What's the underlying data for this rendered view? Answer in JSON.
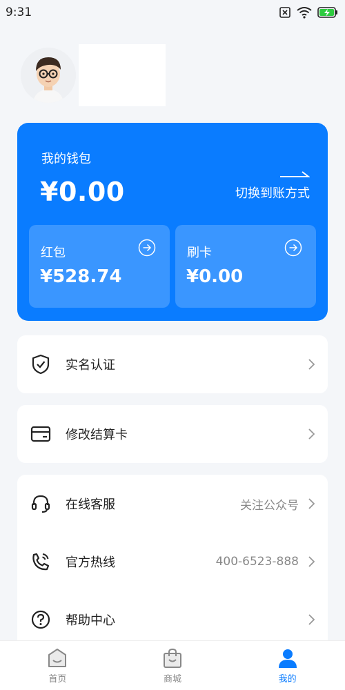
{
  "status_bar": {
    "time": "9:31"
  },
  "wallet": {
    "title": "我的钱包",
    "amount": "¥0.00",
    "switch_label": "切换到账方式",
    "red_packet": {
      "label": "红包",
      "amount": "¥528.74"
    },
    "swipe_card": {
      "label": "刷卡",
      "amount": "¥0.00"
    }
  },
  "menu": {
    "verify": {
      "label": "实名认证"
    },
    "settle_card": {
      "label": "修改结算卡"
    },
    "support": {
      "label": "在线客服",
      "value": "关注公众号"
    },
    "hotline": {
      "label": "官方热线",
      "value": "400-6523-888"
    },
    "help": {
      "label": "帮助中心"
    }
  },
  "tabs": [
    {
      "label": "首页",
      "icon": "home-icon"
    },
    {
      "label": "商城",
      "icon": "shopping-bag-icon"
    },
    {
      "label": "我的",
      "icon": "user-icon"
    }
  ],
  "colors": {
    "accent": "#0a7cff",
    "subcard": "#3a96ff",
    "background": "#f4f6f9"
  }
}
